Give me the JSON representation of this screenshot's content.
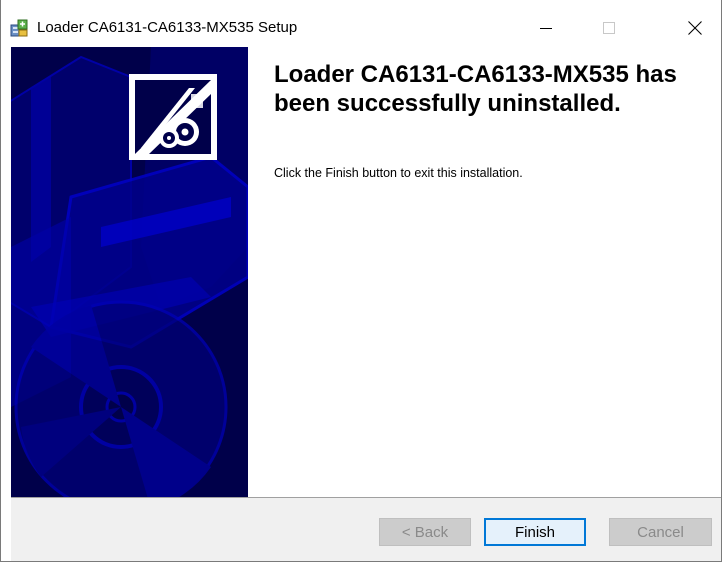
{
  "window": {
    "title": "Loader CA6131-CA6133-MX535 Setup"
  },
  "main": {
    "heading": "Loader CA6131-CA6133-MX535 has been successfully uninstalled.",
    "message": "Click the Finish button to exit this installation."
  },
  "buttons": {
    "back": "< Back",
    "finish": "Finish",
    "cancel": "Cancel"
  },
  "icons": {
    "app": "installer-package-icon",
    "logo": "setup-logo-icon",
    "minimize": "minimize-icon",
    "maximize": "maximize-icon",
    "close": "close-icon"
  },
  "colors": {
    "sidebar_bg": "#00004a",
    "sidebar_accent": "#0000c8",
    "default_button_border": "#0078d7"
  }
}
